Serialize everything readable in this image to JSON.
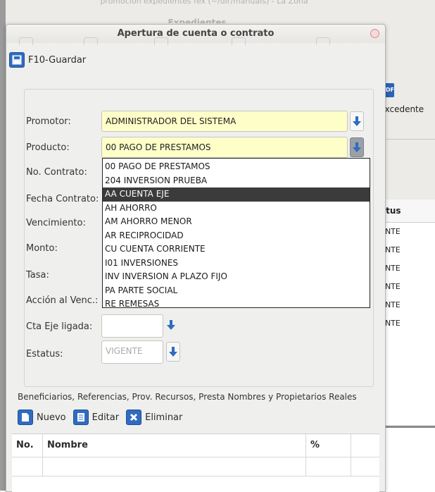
{
  "background": {
    "top_text": "promocion expedientes fex (~/dir/manuals) - La Zona",
    "window_title": "Expedientes",
    "excedente_label": "Excedente",
    "pdf_icon_text": "PDF",
    "table_header": "atus",
    "table_rows": [
      "ENTE",
      "ENTE",
      "ENTE",
      "ENTE",
      "ENTE",
      "ENTE"
    ]
  },
  "dialog": {
    "title": "Apertura de cuenta o contrato",
    "save_label": "F10-Guardar",
    "fields": {
      "promotor_label": "Promotor:",
      "promotor_value": "ADMINISTRADOR DEL SISTEMA",
      "producto_label": "Producto:",
      "producto_value": "00 PAGO DE PRESTAMOS",
      "no_contrato_label": "No. Contrato:",
      "fecha_contrato_label": "Fecha Contrato:",
      "vencimiento_label": "Vencimiento:",
      "monto_label": "Monto:",
      "tasa_label": "Tasa:",
      "accion_label": "Acción al Venc.:",
      "cta_eje_label": "Cta Eje ligada:",
      "cta_eje_value": "",
      "estatus_label": "Estatus:",
      "estatus_value": "VIGENTE"
    },
    "product_options": [
      "00 PAGO DE PRESTAMOS",
      "204 INVERSION PRUEBA",
      "AA CUENTA EJE",
      "AH AHORRO",
      "AM AHORRO MENOR",
      "AR RECIPROCIDAD",
      "CU CUENTA CORRIENTE",
      "I01 INVERSIONES",
      "INV INVERSION A PLAZO FIJO",
      "PA PARTE SOCIAL",
      "RE REMESAS"
    ],
    "highlighted_option": "AA CUENTA EJE",
    "beneficiaries_label": "Beneficiarios, Referencias, Prov. Recursos, Presta Nombres y Propietarios Reales",
    "buttons": {
      "nuevo": "Nuevo",
      "editar": "Editar",
      "eliminar": "Eliminar"
    },
    "grid_headers": {
      "no": "No.",
      "nombre": "Nombre",
      "pct": "%"
    }
  },
  "colors": {
    "accent_blue": "#2f6cc1",
    "field_yellow": "#fefec8",
    "selected_row": "#3b3b3b"
  }
}
